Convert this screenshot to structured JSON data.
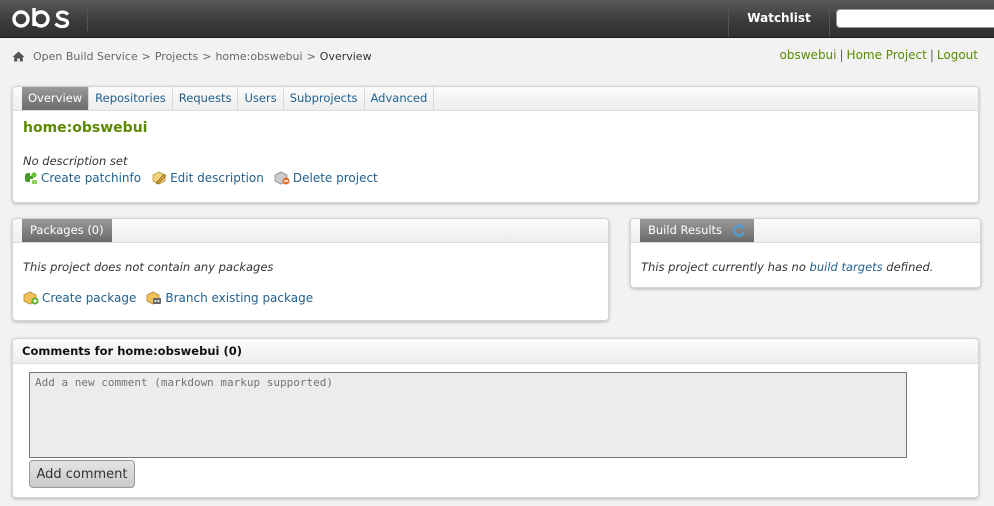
{
  "header": {
    "logo_text": "obs",
    "watchlist_label": "Watchlist",
    "search_value": ""
  },
  "breadcrumb": {
    "items": [
      "Open Build Service",
      "Projects",
      "home:obswebui",
      "Overview"
    ],
    "separator": ">"
  },
  "user_links": {
    "username": "obswebui",
    "home_project": "Home Project",
    "logout": "Logout",
    "divider": "|"
  },
  "project": {
    "tabs": [
      "Overview",
      "Repositories",
      "Requests",
      "Users",
      "Subprojects",
      "Advanced"
    ],
    "active_tab": "Overview",
    "name": "home:obswebui",
    "description": "No description set",
    "actions": {
      "create_patchinfo": "Create patchinfo",
      "edit_description": "Edit description",
      "delete_project": "Delete project"
    }
  },
  "packages": {
    "title": "Packages (0)",
    "empty_text": "This project does not contain any packages",
    "actions": {
      "create_package": "Create package",
      "branch_package": "Branch existing package"
    }
  },
  "build_results": {
    "title": "Build Results",
    "text_before": "This project currently has no ",
    "link": "build targets",
    "text_after": " defined."
  },
  "comments": {
    "title": "Comments for home:obswebui (0)",
    "placeholder": "Add a new comment (markdown markup supported)",
    "button": "Add comment"
  },
  "colors": {
    "link": "#21628f",
    "project_green": "#5b8a00",
    "header_dark": "#3c3c3c"
  }
}
